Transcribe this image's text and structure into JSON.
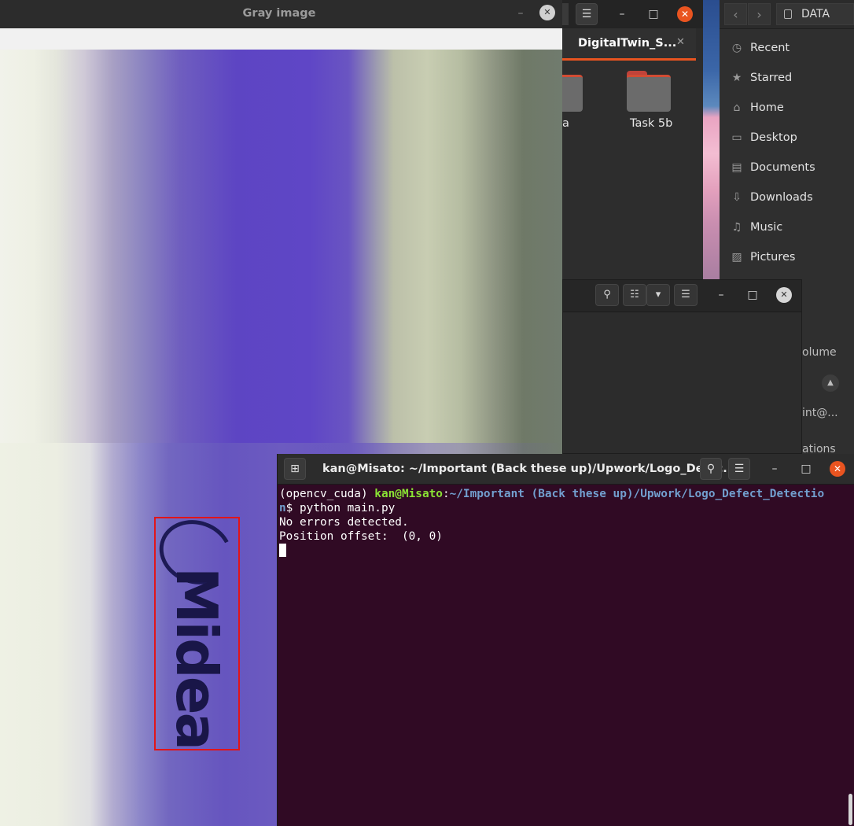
{
  "gray_window": {
    "title": "Gray image",
    "logo_text": "Midea"
  },
  "files_middle": {
    "tab_label": "DigitalTwin_S...",
    "folders": [
      {
        "label": "a"
      },
      {
        "label": "Task 5b"
      }
    ]
  },
  "files_right": {
    "location": "DATA",
    "sidebar": [
      {
        "label": "Recent",
        "icon": "clock-icon"
      },
      {
        "label": "Starred",
        "icon": "star-icon"
      },
      {
        "label": "Home",
        "icon": "home-icon"
      },
      {
        "label": "Desktop",
        "icon": "desktop-icon"
      },
      {
        "label": "Documents",
        "icon": "document-icon"
      },
      {
        "label": "Downloads",
        "icon": "download-icon"
      },
      {
        "label": "Music",
        "icon": "music-icon"
      },
      {
        "label": "Pictures",
        "icon": "picture-icon"
      }
    ],
    "fragments": {
      "volume": "olume",
      "int": "int@...",
      "ations": "ations"
    }
  },
  "terminal": {
    "title": "kan@Misato: ~/Important (Back these up)/Upwork/Logo_Defec...",
    "prompt_env": "(opencv_cuda) ",
    "prompt_user": "kan@Misato",
    "prompt_sep": ":",
    "prompt_path_1": "~/Important (Back these up)/Upwork/Logo_Defect_Detectio",
    "prompt_path_2": "n",
    "command": "$ python main.py",
    "output_1": "No errors detected.",
    "output_2": "Position offset:  (0, 0)"
  },
  "colors": {
    "ubuntu_orange": "#e95420",
    "terminal_bg": "#300a24",
    "detection_box": "#e1151a"
  }
}
